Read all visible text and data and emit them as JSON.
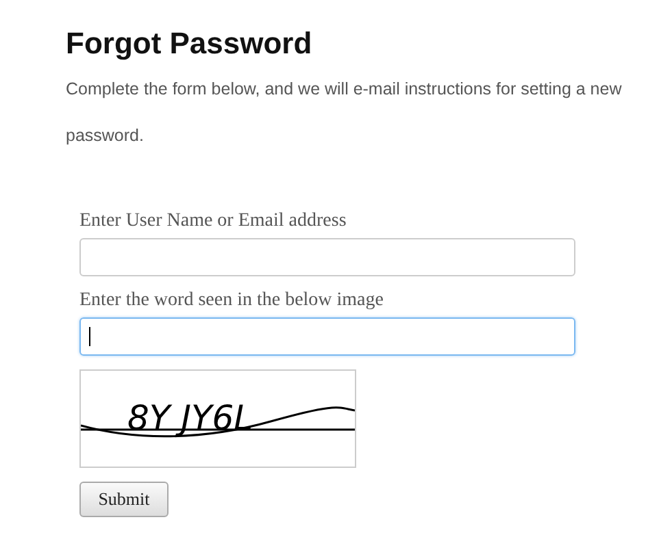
{
  "title": "Forgot Password",
  "description": "Complete the form below, and we will e-mail instructions for setting a new password.",
  "fields": [
    {
      "label": "Enter User Name or Email address",
      "focused": false
    },
    {
      "label": "Enter the word seen in the below image",
      "focused": true
    }
  ],
  "captcha": {
    "text": "8Y JY6L"
  },
  "submit_button": "Submit"
}
